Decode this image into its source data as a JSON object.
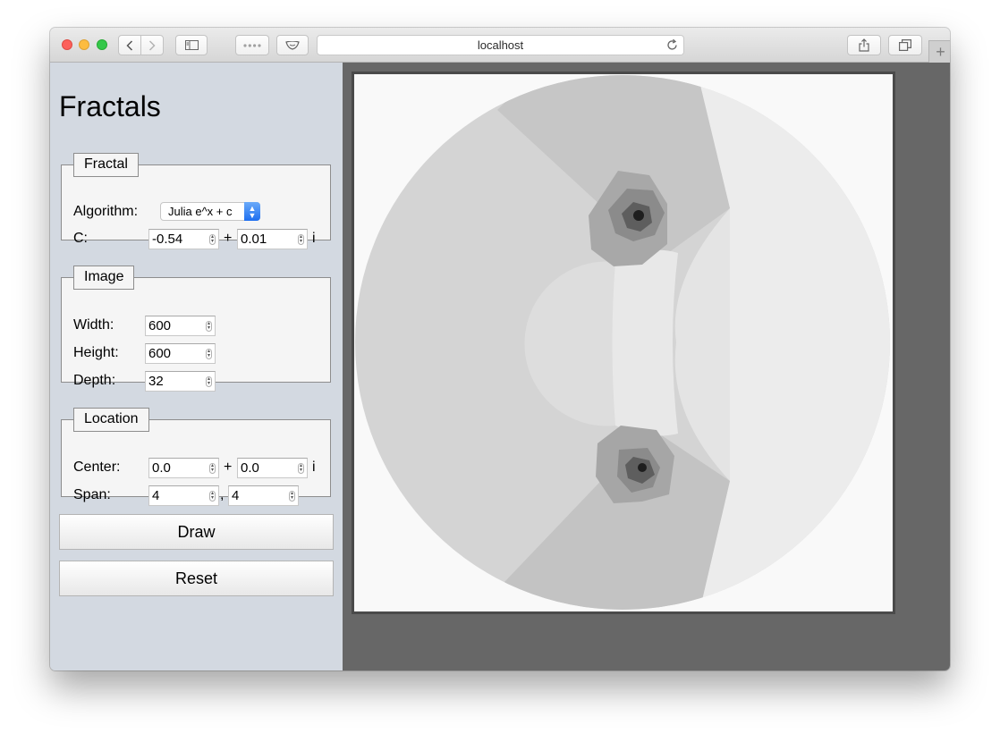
{
  "browser": {
    "url": "localhost"
  },
  "app": {
    "title": "Fractals"
  },
  "fractal_group": {
    "legend": "Fractal",
    "algorithm_label": "Algorithm:",
    "algorithm_value": "Julia e^x + c",
    "c_label": "C:",
    "c_real": "-0.54",
    "plus": "+",
    "c_imag": "0.01",
    "i_suffix": "i"
  },
  "image_group": {
    "legend": "Image",
    "width_label": "Width:",
    "width_value": "600",
    "height_label": "Height:",
    "height_value": "600",
    "depth_label": "Depth:",
    "depth_value": "32"
  },
  "location_group": {
    "legend": "Location",
    "center_label": "Center:",
    "center_real": "0.0",
    "plus": "+",
    "center_imag": "0.0",
    "i_suffix": "i",
    "span_label": "Span:",
    "span_x": "4",
    "comma": ",",
    "span_y": "4"
  },
  "actions": {
    "draw_label": "Draw",
    "reset_label": "Reset"
  },
  "colors": {
    "sidebar_bg": "#d3d9e1",
    "canvas_bg": "#676767",
    "select_accent": "#2f7df5"
  }
}
